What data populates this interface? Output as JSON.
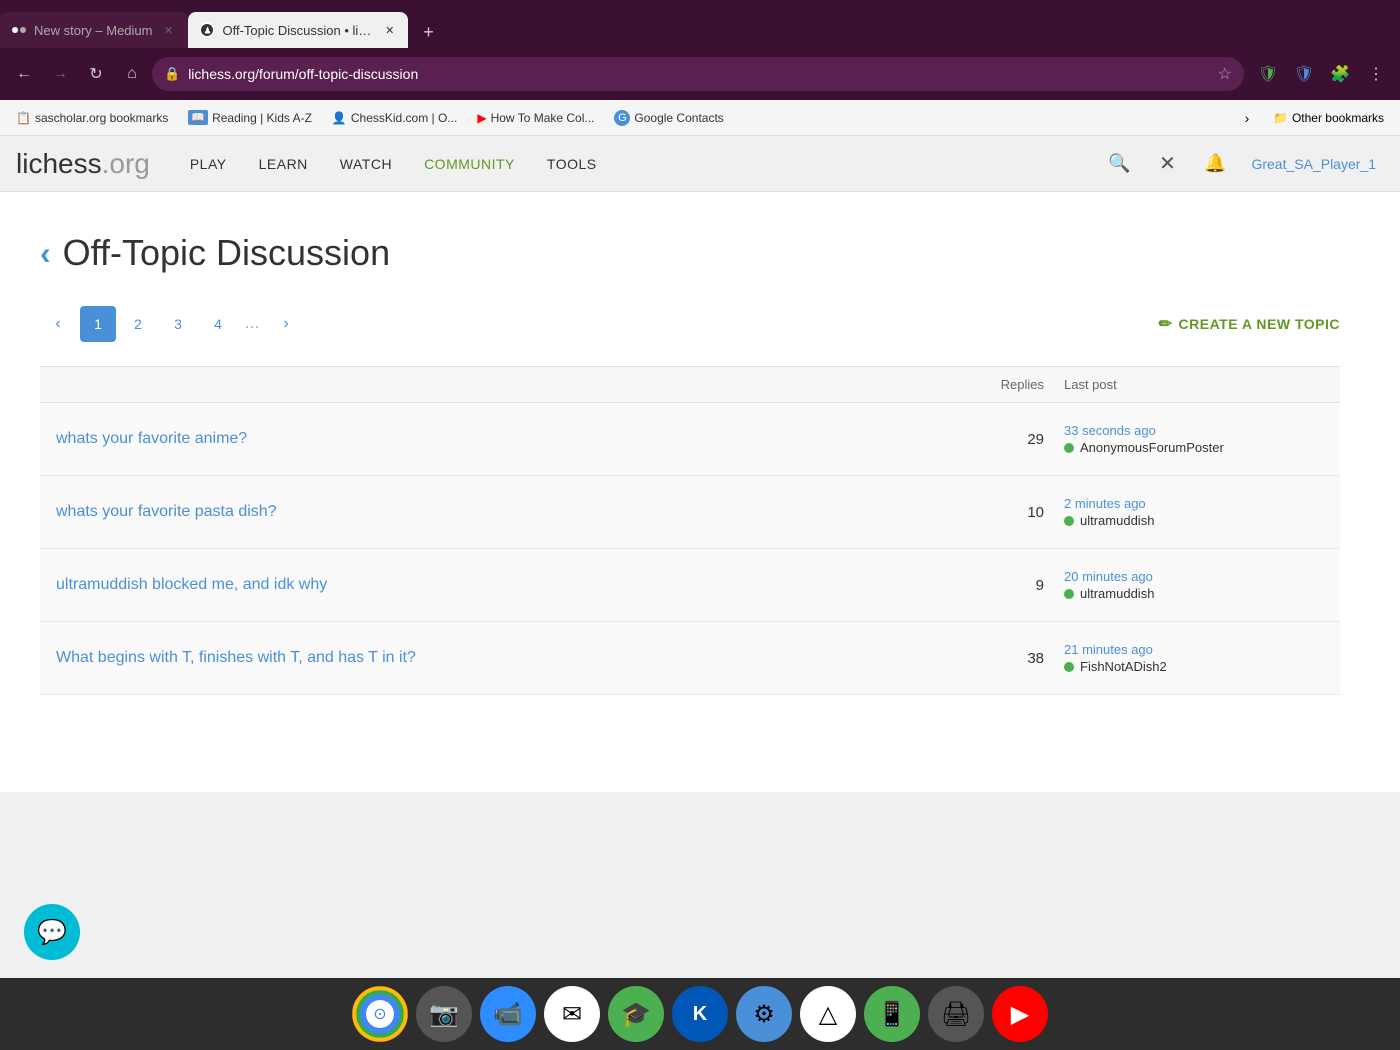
{
  "browser": {
    "tabs": [
      {
        "id": "tab1",
        "title": "New story – Medium",
        "active": false,
        "favicon_type": "medium"
      },
      {
        "id": "tab2",
        "title": "Off-Topic Discussion • lichess...",
        "active": true,
        "favicon_type": "lichess"
      }
    ],
    "add_tab_label": "+",
    "url": "lichess.org/forum/off-topic-discussion",
    "back_disabled": false,
    "forward_disabled": true
  },
  "bookmarks": [
    {
      "id": "bm1",
      "label": "sascholar.org bookmarks",
      "icon": "📋"
    },
    {
      "id": "bm2",
      "label": "Reading | Kids A-Z",
      "icon": "📖"
    },
    {
      "id": "bm3",
      "label": "ChessKid.com | O...",
      "icon": "👤"
    },
    {
      "id": "bm4",
      "label": "How To Make Col...",
      "icon": "▶"
    },
    {
      "id": "bm5",
      "label": "Google Contacts",
      "icon": "👤"
    }
  ],
  "bookmarks_more_label": "›",
  "other_bookmarks_label": "Other bookmarks",
  "nav": {
    "logo_text": "lichess",
    "logo_tld": ".org",
    "items": [
      {
        "id": "play",
        "label": "PLAY"
      },
      {
        "id": "learn",
        "label": "LEARN"
      },
      {
        "id": "watch",
        "label": "WATCH"
      },
      {
        "id": "community",
        "label": "COMMUNITY",
        "active": true
      },
      {
        "id": "tools",
        "label": "TOOLS"
      }
    ],
    "username": "Great_SA_Player_1"
  },
  "page": {
    "back_arrow": "‹",
    "title": "Off-Topic Discussion",
    "pagination": {
      "prev_arrow": "‹",
      "next_arrow": "›",
      "pages": [
        {
          "num": "1",
          "active": true
        },
        {
          "num": "2",
          "active": false
        },
        {
          "num": "3",
          "active": false
        },
        {
          "num": "4",
          "active": false
        }
      ],
      "ellipsis": "…"
    },
    "create_topic_label": "CREATE A NEW TOPIC",
    "table_headers": {
      "replies": "Replies",
      "last_post": "Last post"
    },
    "topics": [
      {
        "id": "t1",
        "title": "whats your favorite anime?",
        "replies": "29",
        "last_post_time": "33 seconds ago",
        "last_post_user": "AnonymousForumPoster",
        "user_online": true
      },
      {
        "id": "t2",
        "title": "whats your favorite pasta dish?",
        "replies": "10",
        "last_post_time": "2 minutes ago",
        "last_post_user": "ultramuddish",
        "user_online": true
      },
      {
        "id": "t3",
        "title": "ultramuddish blocked me, and idk why",
        "replies": "9",
        "last_post_time": "20 minutes ago",
        "last_post_user": "ultramuddish",
        "user_online": true
      },
      {
        "id": "t4",
        "title": "What begins with T, finishes with T, and has T in it?",
        "replies": "38",
        "last_post_time": "21 minutes ago",
        "last_post_user": "FishNotADish2",
        "user_online": true
      }
    ]
  },
  "taskbar": {
    "icons": [
      {
        "id": "chrome",
        "label": "Chrome",
        "bg": "#fff",
        "symbol": "⊙"
      },
      {
        "id": "camera",
        "label": "Camera",
        "bg": "#555",
        "symbol": "📷"
      },
      {
        "id": "zoom",
        "label": "Zoom",
        "bg": "#2d8cff",
        "symbol": "📹"
      },
      {
        "id": "gmail",
        "label": "Gmail",
        "bg": "#fff",
        "symbol": "✉"
      },
      {
        "id": "classroom",
        "label": "Google Classroom",
        "bg": "#4caf50",
        "symbol": "🎓"
      },
      {
        "id": "klack",
        "label": "Klack",
        "bg": "#0057b8",
        "symbol": "K"
      },
      {
        "id": "settings",
        "label": "Settings",
        "bg": "#4a90d9",
        "symbol": "⚙"
      },
      {
        "id": "drive",
        "label": "Google Drive",
        "bg": "#fff",
        "symbol": "△"
      },
      {
        "id": "phone",
        "label": "Phone",
        "bg": "#4caf50",
        "symbol": "📱"
      },
      {
        "id": "print",
        "label": "Print",
        "bg": "#555",
        "symbol": "🖨"
      },
      {
        "id": "youtube",
        "label": "YouTube",
        "bg": "#ff0000",
        "symbol": "▶"
      }
    ]
  },
  "floating_btn": {
    "symbol": "💬"
  }
}
